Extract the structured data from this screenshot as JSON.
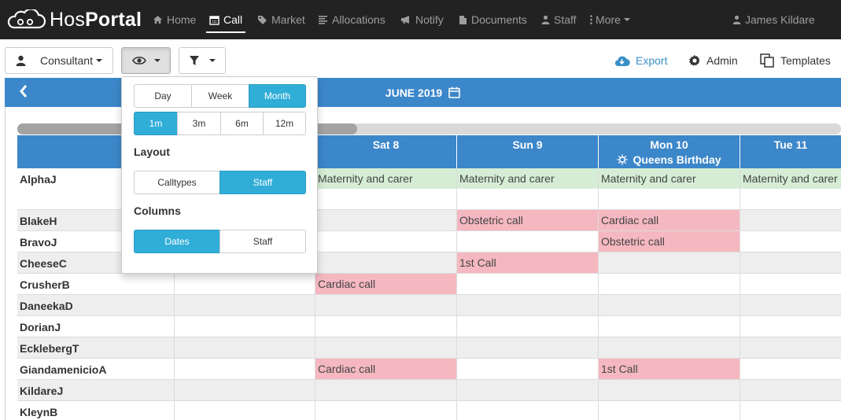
{
  "app": {
    "logo_light": "Hos",
    "logo_bold": "Portal"
  },
  "nav": {
    "items": [
      {
        "label": "Home",
        "icon": "home-icon"
      },
      {
        "label": "Call",
        "icon": "calendar-icon",
        "active": true
      },
      {
        "label": "Market",
        "icon": "tag-icon"
      },
      {
        "label": "Allocations",
        "icon": "list-icon"
      },
      {
        "label": "Notify",
        "icon": "bullhorn-icon"
      },
      {
        "label": "Documents",
        "icon": "file-icon"
      },
      {
        "label": "Staff",
        "icon": "user-icon"
      },
      {
        "label": "More",
        "icon": "ellipsis-vertical-icon"
      }
    ],
    "user": "James Kildare"
  },
  "toolbar": {
    "role_label": "Consultant",
    "export_label": "Export",
    "admin_label": "Admin",
    "templates_label": "Templates"
  },
  "calendar": {
    "title": "JUNE 2019",
    "days": [
      {
        "label": "Sat 8"
      },
      {
        "label": "Sun 9"
      },
      {
        "label": "Mon 10",
        "holiday": "Queens Birthday"
      },
      {
        "label": "Tue 11"
      }
    ],
    "staff": [
      "AlphaJ",
      "BlakeH",
      "BravoJ",
      "CheeseC",
      "CrusherB",
      "DaneekaD",
      "DorianJ",
      "EcklebergT",
      "GiandamenicioA",
      "KildareJ",
      "KleynB"
    ],
    "cells": {
      "alpha_sat": "Maternity and carer",
      "alpha_sun": "Maternity and carer",
      "alpha_mon": "Maternity and carer",
      "alpha_tue": "Maternity and carer",
      "blake_sun": "Obstetric call",
      "blake_mon": "Cardiac call",
      "bravo_mon": "Obstetric call",
      "cheese_sun": "1st Call",
      "crusher_sat": "Cardiac call",
      "gianda_sat": "Cardiac call",
      "gianda_mon": "1st Call"
    },
    "colors": {
      "header": "#3c87c9",
      "leave": "#d4edd4",
      "call": "#f5b8c1"
    }
  },
  "view_popover": {
    "period_options": [
      "Day",
      "Week",
      "Month"
    ],
    "period_selected": "Month",
    "range_options": [
      "1m",
      "3m",
      "6m",
      "12m"
    ],
    "range_selected": "1m",
    "layout_label": "Layout",
    "layout_options": [
      "Calltypes",
      "Staff"
    ],
    "layout_selected": "Staff",
    "columns_label": "Columns",
    "columns_options": [
      "Dates",
      "Staff"
    ],
    "columns_selected": "Dates",
    "accent": "#31aed7"
  }
}
